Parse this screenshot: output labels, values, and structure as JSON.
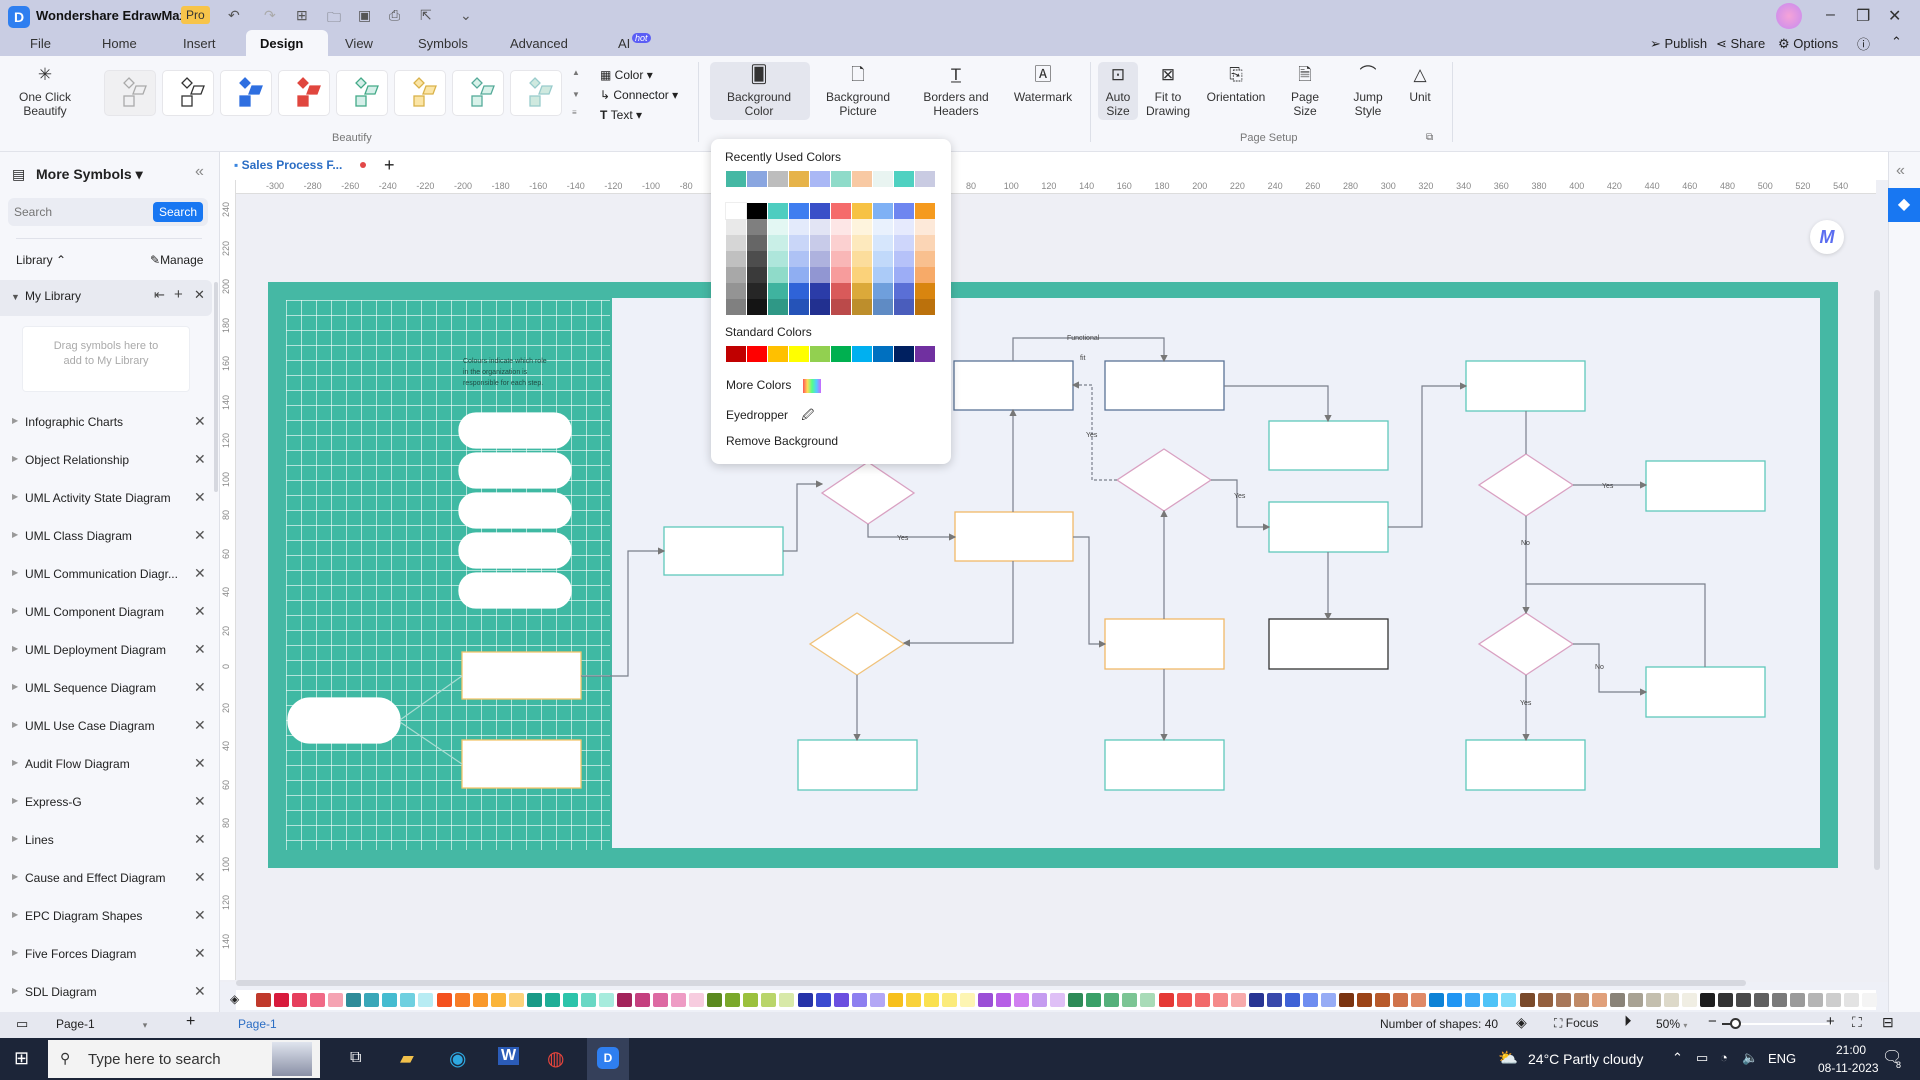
{
  "app": {
    "title": "Wondershare EdrawMax",
    "badge": "Pro"
  },
  "menu": {
    "tabs": [
      "File",
      "Home",
      "Insert",
      "Design",
      "View",
      "Symbols",
      "Advanced",
      "AI"
    ],
    "active": "Design",
    "ai_badge": "hot"
  },
  "header_right": {
    "publish": "Publish",
    "share": "Share",
    "options": "Options",
    "help": "?"
  },
  "ribbon": {
    "one_click_beautify": "One Click Beautify",
    "beautify_group_label": "Beautify",
    "style_options": [
      "Color",
      "Connector",
      "Text"
    ],
    "page_setup_label": "Page Setup",
    "buttons": [
      {
        "id": "bg-color",
        "label": "Background Color"
      },
      {
        "id": "bg-picture",
        "label": "Background Picture"
      },
      {
        "id": "borders-headers",
        "label": "Borders and Headers"
      },
      {
        "id": "watermark",
        "label": "Watermark"
      },
      {
        "id": "auto-size",
        "label": "Auto Size"
      },
      {
        "id": "fit-drawing",
        "label": "Fit to Drawing"
      },
      {
        "id": "orientation",
        "label": "Orientation"
      },
      {
        "id": "page-size",
        "label": "Page Size"
      },
      {
        "id": "jump-style",
        "label": "Jump Style"
      },
      {
        "id": "unit",
        "label": "Unit"
      }
    ]
  },
  "bg_color_popup": {
    "recent_label": "Recently Used Colors",
    "recent": [
      "#45b8a4",
      "#8aa6e0",
      "#bdbdbd",
      "#e6b34a",
      "#aab8f5",
      "#8fdbc9",
      "#f8c9a3",
      "#e9f4f1",
      "#4fd1c1",
      "#c9cbe2"
    ],
    "theme_top": [
      "#ffffff",
      "#000000",
      "#4ecdc0",
      "#3f7ef0",
      "#3950c8",
      "#f56b6b",
      "#f7c244",
      "#7fb1f5",
      "#6e86f0",
      "#f59a1e"
    ],
    "theme_columns": [
      [
        "#e9e9e9",
        "#d6d6d6",
        "#c0c0c0",
        "#a8a8a8",
        "#949494",
        "#808080"
      ],
      [
        "#7f7f7f",
        "#666666",
        "#4d4d4d",
        "#3a3a3a",
        "#262626",
        "#141414"
      ],
      [
        "#e3f7f3",
        "#c9efe7",
        "#aee6db",
        "#8fdbc9",
        "#3fb39f",
        "#2f9886"
      ],
      [
        "#e3eafb",
        "#c9d6f8",
        "#aec2f5",
        "#8faef2",
        "#2f63d8",
        "#2553b8"
      ],
      [
        "#e2e4f4",
        "#c8cbe9",
        "#aeb2de",
        "#9196d2",
        "#2b3ca8",
        "#223090"
      ],
      [
        "#fde6e6",
        "#fbd0d0",
        "#f9b7b7",
        "#f79c9c",
        "#d95a5a",
        "#bb4a4a"
      ],
      [
        "#fef4dd",
        "#fde9bd",
        "#fcdd9c",
        "#fbd27a",
        "#dba93a",
        "#bd8e2c"
      ],
      [
        "#e9f1fd",
        "#d6e6fc",
        "#c1d9fa",
        "#abcbf8",
        "#6f9fdc",
        "#5f8bc4"
      ],
      [
        "#e6eafd",
        "#ced6fb",
        "#b6c2f9",
        "#9cadf6",
        "#5a6fd6",
        "#4a5dbc"
      ],
      [
        "#fde9d9",
        "#fbd5b5",
        "#f9c08f",
        "#f7aa68",
        "#d9850f",
        "#bb710c"
      ]
    ],
    "standard_label": "Standard Colors",
    "standard": [
      "#c00000",
      "#ff0000",
      "#ffc000",
      "#ffff00",
      "#92d050",
      "#00b050",
      "#00b0f0",
      "#0070c0",
      "#002060",
      "#7030a0"
    ],
    "more_colors": "More Colors",
    "eyedropper": "Eyedropper",
    "remove_background": "Remove Background"
  },
  "sidebar": {
    "title": "More Symbols",
    "search_placeholder": "Search",
    "search_button": "Search",
    "library_label": "Library",
    "manage": "Manage",
    "my_library": "My Library",
    "drop_hint": "Drag symbols here to add to My Library",
    "items": [
      "Infographic Charts",
      "Object Relationship",
      "UML Activity State Diagram",
      "UML Class Diagram",
      "UML Communication Diagr...",
      "UML Component Diagram",
      "UML Deployment Diagram",
      "UML Sequence Diagram",
      "UML Use Case Diagram",
      "Audit Flow Diagram",
      "Express-G",
      "Lines",
      "Cause and Effect Diagram",
      "EPC Diagram Shapes",
      "Five Forces Diagram",
      "SDL Diagram"
    ]
  },
  "document_tab": {
    "name": "Sales Process F...",
    "unsaved": true
  },
  "rulers": {
    "horizontal": [
      "-300",
      "-280",
      "-260",
      "-240",
      "-220",
      "-200",
      "-180",
      "-160",
      "-140",
      "-120",
      "-100",
      "-80",
      "80",
      "100",
      "120",
      "140",
      "160",
      "180",
      "200",
      "220",
      "240",
      "260",
      "280",
      "300",
      "320",
      "340",
      "360",
      "380",
      "400",
      "420",
      "440",
      "460",
      "480",
      "500",
      "520",
      "540"
    ],
    "vertical": [
      "240",
      "220",
      "200",
      "180",
      "160",
      "140",
      "120",
      "100",
      "80",
      "60",
      "40",
      "20",
      "0",
      "20",
      "40",
      "60",
      "80",
      "100",
      "120",
      "140"
    ]
  },
  "diagram": {
    "note": "Colours indicate which role in the organization is responsible for each step.",
    "labels": {
      "functional": "Functional",
      "fit": "fit",
      "yes": "Yes",
      "no": "No"
    }
  },
  "palette_colors": [
    "#c0392b",
    "#d81b3c",
    "#e63e5c",
    "#f06a86",
    "#f5a3b2",
    "#2f8c99",
    "#39a7b8",
    "#45bcd0",
    "#6fd0e0",
    "#b7ecf3",
    "#f4511e",
    "#f77c26",
    "#f9992b",
    "#fbb53a",
    "#fcd27a",
    "#1a9a86",
    "#1fae96",
    "#2cc4aa",
    "#6ad8c4",
    "#a7ecdd",
    "#a3245a",
    "#c5407e",
    "#dd6aa2",
    "#ee9cc4",
    "#f7ccdf",
    "#5b8a1f",
    "#7aa82b",
    "#9bc13d",
    "#b9d56a",
    "#d8e9a8",
    "#2733a8",
    "#3b4ad0",
    "#6b4fe0",
    "#8d7ff0",
    "#b3a7f5",
    "#f7c01b",
    "#f9d23a",
    "#fae14f",
    "#fbeb7c",
    "#fdf5b3",
    "#9b4fd6",
    "#b75fe6",
    "#d07ff0",
    "#c59cf0",
    "#dfc0f6",
    "#2e8b57",
    "#3aa067",
    "#55b07a",
    "#7cc594",
    "#a8dbb7",
    "#e53935",
    "#ef5350",
    "#f26b6b",
    "#f58a8a",
    "#f7aaaa",
    "#283593",
    "#3949ab",
    "#3f62d6",
    "#6e8df0",
    "#97acf5",
    "#7b3410",
    "#9c4416",
    "#b85a2a",
    "#d0734a",
    "#e08a66",
    "#0d82d6",
    "#2196f3",
    "#3eaaf6",
    "#4fc3f7",
    "#7fdcf9",
    "#7a4a2a",
    "#94603e",
    "#a8785a",
    "#c08a66",
    "#e0a07a",
    "#8a8378",
    "#a8a293",
    "#c4bfae",
    "#ddd9c9",
    "#f0eee3",
    "#1e1e1e",
    "#333333",
    "#4a4a4a",
    "#606060",
    "#7a7a7a",
    "#9a9a9a",
    "#b5b5b5",
    "#cdcdcd",
    "#e3e3e3",
    "#f4f4f4"
  ],
  "statusbar": {
    "page_selector": "Page-1",
    "page_tab": "Page-1",
    "shapes": "Number of shapes: 40",
    "focus": "Focus",
    "zoom": "50%"
  },
  "taskbar": {
    "search_placeholder": "Type here to search",
    "weather": "24°C  Partly cloudy",
    "lang": "ENG",
    "time": "21:00",
    "date": "08-11-2023",
    "notifications": "8"
  }
}
